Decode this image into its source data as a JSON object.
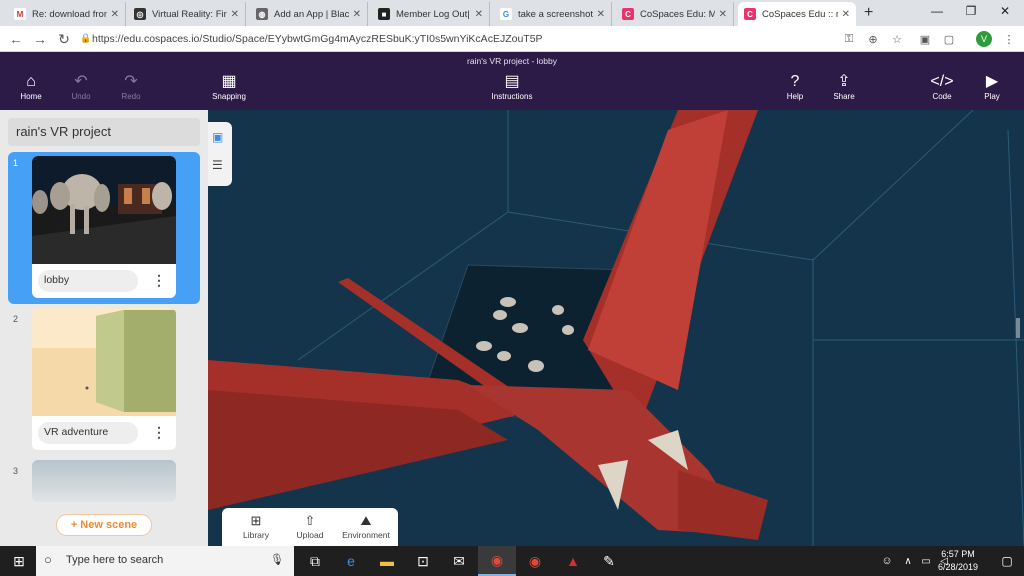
{
  "browser": {
    "tabs": [
      {
        "title": "Re: download from",
        "icon": "gmail-icon",
        "color": "#d93025"
      },
      {
        "title": "Virtual Reality: Fin",
        "icon": "compass-icon",
        "color": "#333333"
      },
      {
        "title": "Add an App | Black",
        "icon": "globe-icon",
        "color": "#555555"
      },
      {
        "title": "Member Log Out|",
        "icon": "site-icon",
        "color": "#222222"
      },
      {
        "title": "take a screenshot",
        "icon": "google-icon",
        "color": "#4285f4"
      },
      {
        "title": "CoSpaces Edu: Ma",
        "icon": "cospaces-icon",
        "color": "#e8336b"
      },
      {
        "title": "CoSpaces Edu :: ra",
        "icon": "cospaces-icon",
        "color": "#e8336b"
      }
    ],
    "new_tab": "+",
    "url": "https://edu.cospaces.io/Studio/Space/EYybwtGmGg4mAyczRESbuK:yTI0s5wnYiKcAcEJZouT5P",
    "profile_initial": "V"
  },
  "app": {
    "title": "rain's VR project - lobby",
    "buttons": {
      "home": "Home",
      "undo": "Undo",
      "redo": "Redo",
      "snapping": "Snapping",
      "instructions": "Instructions",
      "help": "Help",
      "share": "Share",
      "code": "Code",
      "play": "Play"
    }
  },
  "panel": {
    "project_name": "rain's VR project",
    "scenes": [
      {
        "number": "1",
        "label": "lobby"
      },
      {
        "number": "2",
        "label": "VR adventure"
      },
      {
        "number": "3",
        "label": ""
      }
    ],
    "new_scene": "+ New scene"
  },
  "bottom_toolbar": {
    "library": "Library",
    "upload": "Upload",
    "environment": "Environment"
  },
  "taskbar": {
    "search_placeholder": "Type here to search",
    "time": "6:57 PM",
    "date": "6/28/2019"
  }
}
